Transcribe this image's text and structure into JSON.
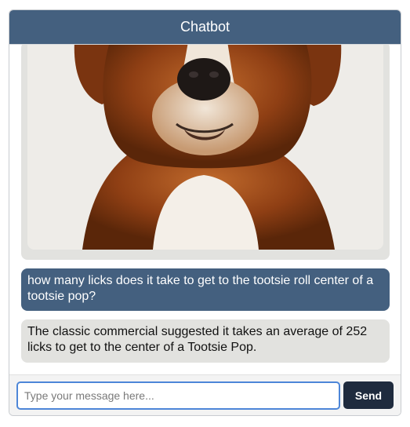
{
  "header": {
    "title": "Chatbot"
  },
  "messages": [
    {
      "role": "bot",
      "type": "image",
      "image": "dog-photo"
    },
    {
      "role": "user",
      "type": "text",
      "text": "how many licks does it take to get to the tootsie roll center of a tootsie pop?"
    },
    {
      "role": "bot",
      "type": "text",
      "text": "The classic commercial suggested it takes an average of 252 licks to get to the center of a Tootsie Pop."
    }
  ],
  "input": {
    "placeholder": "Type your message here...",
    "value": ""
  },
  "send_button": {
    "label": "Send"
  },
  "colors": {
    "header": "#44607f",
    "user_bubble": "#44607f",
    "bot_bubble": "#e2e2df",
    "send_button": "#1f2b3e",
    "input_focus": "#4d86d8"
  }
}
